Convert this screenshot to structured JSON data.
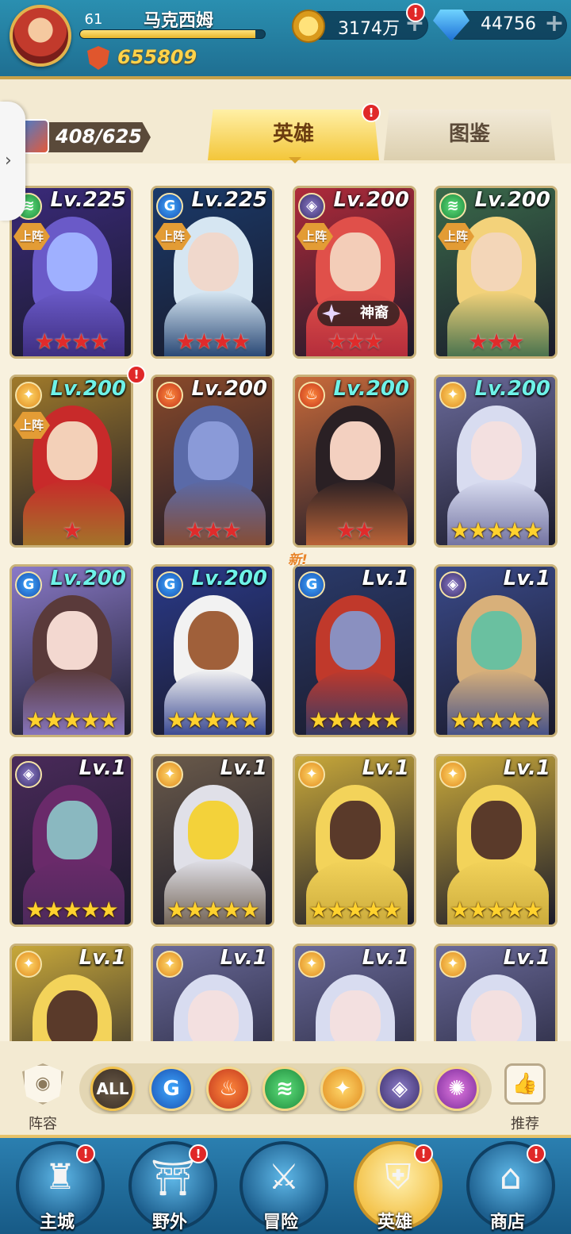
{
  "player": {
    "level": "61",
    "name": "马克西姆",
    "power": "655809",
    "xp_fraction": 0.95
  },
  "resources": {
    "gold": "3174万",
    "gems": "44756",
    "plus": "+",
    "alert": "!"
  },
  "collection": {
    "count": "408/625"
  },
  "tabs": {
    "heroes": "英雄",
    "codex": "图鉴"
  },
  "labels": {
    "deploy": "上阵",
    "shenyi": "神裔",
    "new": "新!"
  },
  "element_colors": {
    "water": "#2a7fe0",
    "fire": "#e0562d",
    "wind": "#2fb04c",
    "light": "#f0a22a",
    "dark": "#5a4a9a",
    "chaos": "#a03ac0"
  },
  "heroes": [
    {
      "level": "Lv.225",
      "element": "wind",
      "deployed": true,
      "stars": 4,
      "star_color": "red",
      "lv_style": "white",
      "palette": [
        "#3a2a7a",
        "#6a5ac8",
        "#9fb0ff"
      ]
    },
    {
      "level": "Lv.225",
      "element": "water",
      "deployed": true,
      "stars": 4,
      "star_color": "red",
      "lv_style": "white",
      "palette": [
        "#1a3a6a",
        "#d6e6f2",
        "#f0d8cc"
      ]
    },
    {
      "level": "Lv.200",
      "element": "dark",
      "deployed": true,
      "stars": 3,
      "star_color": "red",
      "lv_style": "white",
      "palette": [
        "#b02a3a",
        "#e0504a",
        "#f3cdb8"
      ],
      "shenyi": true
    },
    {
      "level": "Lv.200",
      "element": "wind",
      "deployed": true,
      "stars": 3,
      "star_color": "red",
      "lv_style": "white",
      "palette": [
        "#3a6a4a",
        "#f3d27a",
        "#f3d6b8"
      ]
    },
    {
      "level": "Lv.200",
      "element": "light",
      "deployed": true,
      "stars": 1,
      "star_color": "red",
      "lv_style": "cyan",
      "palette": [
        "#a07a2a",
        "#c82a2a",
        "#f3d0b8"
      ],
      "alert": true
    },
    {
      "level": "Lv.200",
      "element": "fire",
      "deployed": false,
      "stars": 3,
      "star_color": "red",
      "lv_style": "white",
      "palette": [
        "#8a4a2a",
        "#5a6aa8",
        "#8a9ad8"
      ]
    },
    {
      "level": "Lv.200",
      "element": "fire",
      "deployed": false,
      "stars": 2,
      "star_color": "red",
      "lv_style": "cyan",
      "palette": [
        "#c86a3a",
        "#2a2024",
        "#f3d0c0"
      ]
    },
    {
      "level": "Lv.200",
      "element": "light",
      "deployed": false,
      "stars": 5,
      "star_color": "gold",
      "lv_style": "cyan",
      "palette": [
        "#6a6a9a",
        "#d8dcf0",
        "#f3e0e0"
      ]
    },
    {
      "level": "Lv.200",
      "element": "water",
      "deployed": false,
      "stars": 5,
      "star_color": "gold",
      "lv_style": "cyan",
      "palette": [
        "#8a7ac8",
        "#5a3a3a",
        "#f3d8d0"
      ]
    },
    {
      "level": "Lv.200",
      "element": "water",
      "deployed": false,
      "stars": 5,
      "star_color": "gold",
      "lv_style": "cyan",
      "palette": [
        "#2a3a8a",
        "#f2f2f2",
        "#a0603a"
      ]
    },
    {
      "level": "Lv.1",
      "element": "water",
      "deployed": false,
      "stars": 5,
      "star_color": "gold",
      "lv_style": "white",
      "palette": [
        "#2a3a6a",
        "#c0392b",
        "#8a90c0"
      ],
      "new": true
    },
    {
      "level": "Lv.1",
      "element": "dark",
      "deployed": false,
      "stars": 5,
      "star_color": "gold",
      "lv_style": "white",
      "palette": [
        "#3a4a8a",
        "#d8b07a",
        "#6ac0a0"
      ]
    },
    {
      "level": "Lv.1",
      "element": "dark",
      "deployed": false,
      "stars": 5,
      "star_color": "gold",
      "lv_style": "white",
      "palette": [
        "#4a2a5a",
        "#6a2a6a",
        "#8ab8c0"
      ]
    },
    {
      "level": "Lv.1",
      "element": "light",
      "deployed": false,
      "stars": 5,
      "star_color": "gold",
      "lv_style": "white",
      "palette": [
        "#6a5a4a",
        "#e0e0e8",
        "#f3d23a"
      ]
    },
    {
      "level": "Lv.1",
      "element": "light",
      "deployed": false,
      "stars": 5,
      "star_color": "gold",
      "lv_style": "white",
      "palette": [
        "#c8a83a",
        "#f3d35a",
        "#5a3a2a"
      ]
    },
    {
      "level": "Lv.1",
      "element": "light",
      "deployed": false,
      "stars": 5,
      "star_color": "gold",
      "lv_style": "white",
      "palette": [
        "#c8a83a",
        "#f3d35a",
        "#5a3a2a"
      ]
    },
    {
      "level": "Lv.1",
      "element": "light",
      "deployed": false,
      "stars": 0,
      "star_color": "gold",
      "lv_style": "white",
      "palette": [
        "#c8a83a",
        "#f3d35a",
        "#5a3a2a"
      ]
    },
    {
      "level": "Lv.1",
      "element": "light",
      "deployed": false,
      "stars": 0,
      "star_color": "gold",
      "lv_style": "white",
      "palette": [
        "#6a6a9a",
        "#d8dcf0",
        "#f3e0e0"
      ]
    },
    {
      "level": "Lv.1",
      "element": "light",
      "deployed": false,
      "stars": 0,
      "star_color": "gold",
      "lv_style": "white",
      "palette": [
        "#6a6a9a",
        "#d8dcf0",
        "#f3e0e0"
      ]
    },
    {
      "level": "Lv.1",
      "element": "light",
      "deployed": false,
      "stars": 0,
      "star_color": "gold",
      "lv_style": "white",
      "palette": [
        "#6a6a9a",
        "#d8dcf0",
        "#f3e0e0"
      ]
    }
  ],
  "filters": {
    "lineup_label": "阵容",
    "recommend_label": "推荐",
    "all_label": "ALL",
    "elements": [
      "water",
      "fire",
      "wind",
      "light",
      "dark",
      "chaos"
    ]
  },
  "nav": [
    {
      "label": "主城",
      "icon": "castle-icon",
      "glyph": "♜",
      "alert": true
    },
    {
      "label": "野外",
      "icon": "portal-icon",
      "glyph": "⛩",
      "alert": true
    },
    {
      "label": "冒险",
      "icon": "sword-icon",
      "glyph": "⚔",
      "alert": false
    },
    {
      "label": "英雄",
      "icon": "helmet-icon",
      "glyph": "⛨",
      "alert": true,
      "active": true
    },
    {
      "label": "商店",
      "icon": "shop-icon",
      "glyph": "⌂",
      "alert": true
    }
  ]
}
